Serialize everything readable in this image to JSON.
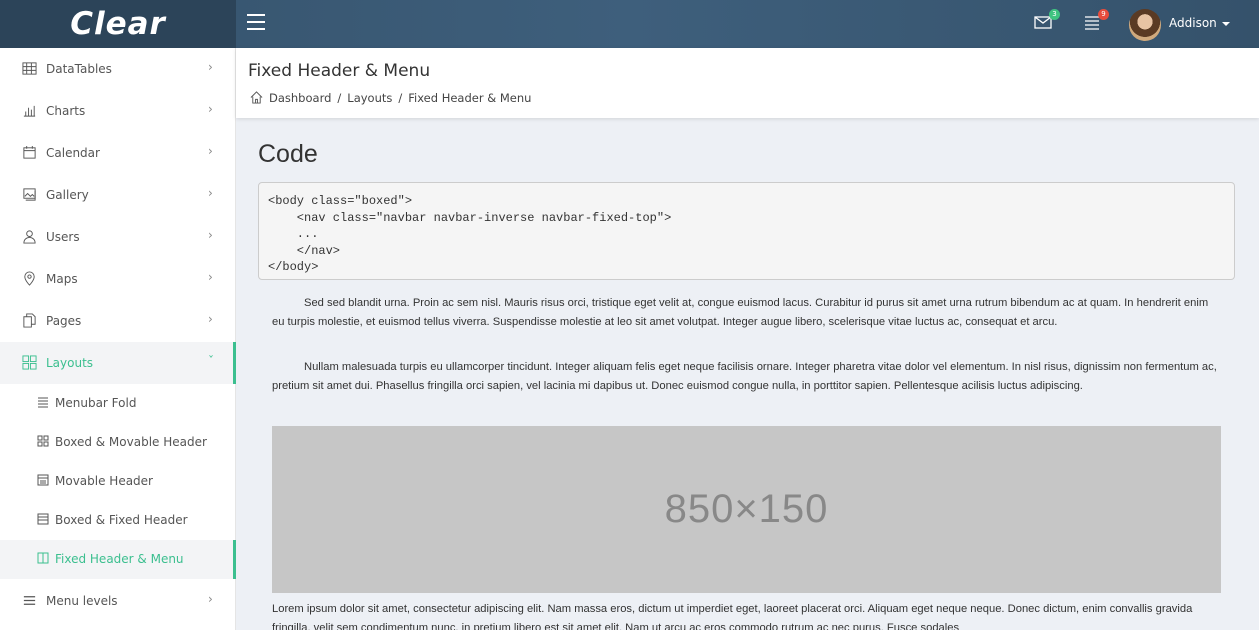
{
  "brand": {
    "logo_text": "Clear"
  },
  "topbar": {
    "user_name": "Addison",
    "mail_badge": "3",
    "tasks_badge": "9"
  },
  "sidebar": {
    "items": [
      {
        "label": "DataTables",
        "icon": "table-icon"
      },
      {
        "label": "Charts",
        "icon": "chart-icon"
      },
      {
        "label": "Calendar",
        "icon": "calendar-icon"
      },
      {
        "label": "Gallery",
        "icon": "gallery-icon"
      },
      {
        "label": "Users",
        "icon": "user-icon"
      },
      {
        "label": "Maps",
        "icon": "map-pin-icon"
      },
      {
        "label": "Pages",
        "icon": "pages-icon"
      },
      {
        "label": "Layouts",
        "icon": "layouts-icon"
      }
    ],
    "layouts_subitems": [
      {
        "label": "Menubar Fold",
        "icon": "menubar-icon"
      },
      {
        "label": "Boxed & Movable Header",
        "icon": "boxed-grid-icon"
      },
      {
        "label": "Movable Header",
        "icon": "movable-header-icon"
      },
      {
        "label": "Boxed & Fixed Header",
        "icon": "fixed-header-icon"
      },
      {
        "label": "Fixed Header & Menu",
        "icon": "columns-icon"
      }
    ],
    "menu_levels": {
      "label": "Menu levels",
      "icon": "menu-icon"
    }
  },
  "page_header": {
    "title": "Fixed Header & Menu",
    "breadcrumb": [
      "Dashboard",
      "Layouts",
      "Fixed Header & Menu"
    ],
    "separator": "/"
  },
  "content": {
    "heading": "Code",
    "code": "<body class=\"boxed\">\n    <nav class=\"navbar navbar-inverse navbar-fixed-top\">\n    ...\n    </nav>\n</body>",
    "paragraph_1": "Sed sed blandit urna. Proin ac sem nisl. Mauris risus orci, tristique eget velit at, congue euismod lacus. Curabitur id purus sit amet urna rutrum bibendum ac at quam. In hendrerit enim eu turpis molestie, et euismod tellus viverra. Suspendisse molestie at leo sit amet volutpat. Integer augue libero, scelerisque vitae luctus ac, consequat et arcu.",
    "paragraph_2": "Nullam malesuada turpis eu ullamcorper tincidunt. Integer aliquam felis eget neque facilisis ornare. Integer pharetra vitae dolor vel elementum. In nisl risus, dignissim non fermentum ac, pretium sit amet dui. Phasellus fringilla orci sapien, vel lacinia mi dapibus ut. Donec euismod congue nulla, in porttitor sapien. Pellentesque acilisis luctus adipiscing.",
    "placeholder_label": "850×150",
    "paragraph_3": "Lorem ipsum dolor sit amet, consectetur adipiscing elit. Nam massa eros, dictum ut imperdiet eget, laoreet placerat orci. Aliquam eget neque neque. Donec dictum, enim convallis gravida fringilla, velit sem condimentum nunc, in pretium libero est sit amet elit. Nam ut arcu ac eros commodo rutrum ac nec purus. Fusce sodales"
  },
  "colors": {
    "topbar": "#3e5f7c",
    "brand_bg": "#2c4459",
    "accent": "#3bbf8f",
    "page_bg": "#edf0f5"
  }
}
